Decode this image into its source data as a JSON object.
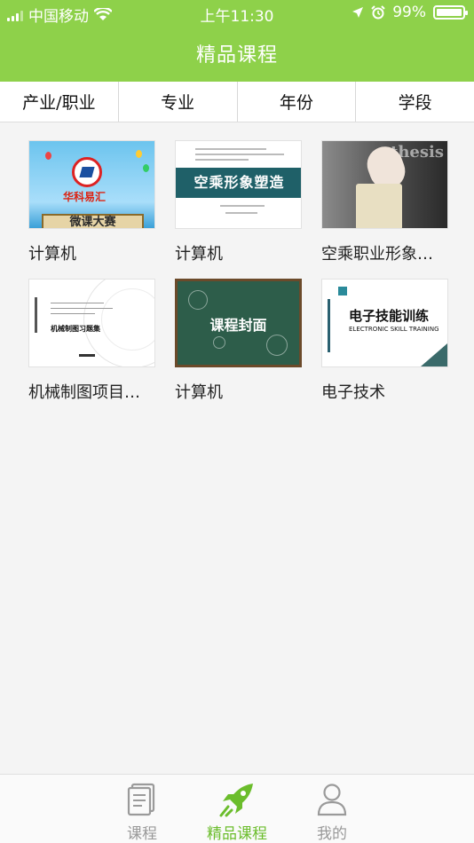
{
  "status_bar": {
    "carrier": "中国移动",
    "time": "上午11:30",
    "battery": "99%",
    "battery_level": 0.99,
    "icons": [
      "signal-icon",
      "wifi-icon",
      "location-icon",
      "alarm-icon",
      "battery-icon"
    ]
  },
  "header": {
    "title": "精品课程",
    "background": "#8ed14a"
  },
  "filters": [
    {
      "label": "产业/职业"
    },
    {
      "label": "专业"
    },
    {
      "label": "年份"
    },
    {
      "label": "学段"
    }
  ],
  "courses": [
    {
      "title": "计算机",
      "cover": {
        "brand": "华科易汇",
        "banner": "微课大赛"
      }
    },
    {
      "title": "计算机",
      "cover": {
        "heading": "空乘形象塑造"
      }
    },
    {
      "title": "空乘职业形象…",
      "cover": {
        "text": "thesis"
      }
    },
    {
      "title": "机械制图项目…",
      "cover": {
        "heading": "机械制图习题集"
      }
    },
    {
      "title": "计算机",
      "cover": {
        "heading": "课程封面"
      }
    },
    {
      "title": "电子技术",
      "cover": {
        "heading": "电子技能训练",
        "subtitle": "ELECTRONIC SKILL TRAINING"
      }
    }
  ],
  "tabbar": {
    "items": [
      {
        "label": "课程",
        "icon": "document-icon",
        "active": false
      },
      {
        "label": "精品课程",
        "icon": "rocket-icon",
        "active": true
      },
      {
        "label": "我的",
        "icon": "user-icon",
        "active": false
      }
    ],
    "active_color": "#6bbd2c"
  }
}
